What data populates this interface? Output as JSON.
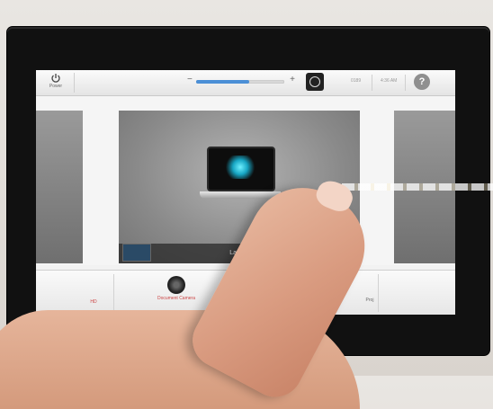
{
  "topbar": {
    "power_label": "Power",
    "volume": {
      "minus": "−",
      "plus": "+",
      "level": 0.6
    },
    "status_left": "0189",
    "status_right": "4:36 AM",
    "help_label": "?"
  },
  "main_source": {
    "label": "Laptop"
  },
  "sources": [
    {
      "label": "HD"
    },
    {
      "label": "Document Camera"
    },
    {
      "label": ""
    },
    {
      "label": "Proj"
    }
  ],
  "colors": {
    "accent": "#4b8fd6",
    "source_label": "#cc4444"
  },
  "icons": {
    "power": "power-icon",
    "mute": "mute-icon",
    "help": "help-icon",
    "laptop": "laptop-icon",
    "document_camera": "document-camera-icon"
  }
}
